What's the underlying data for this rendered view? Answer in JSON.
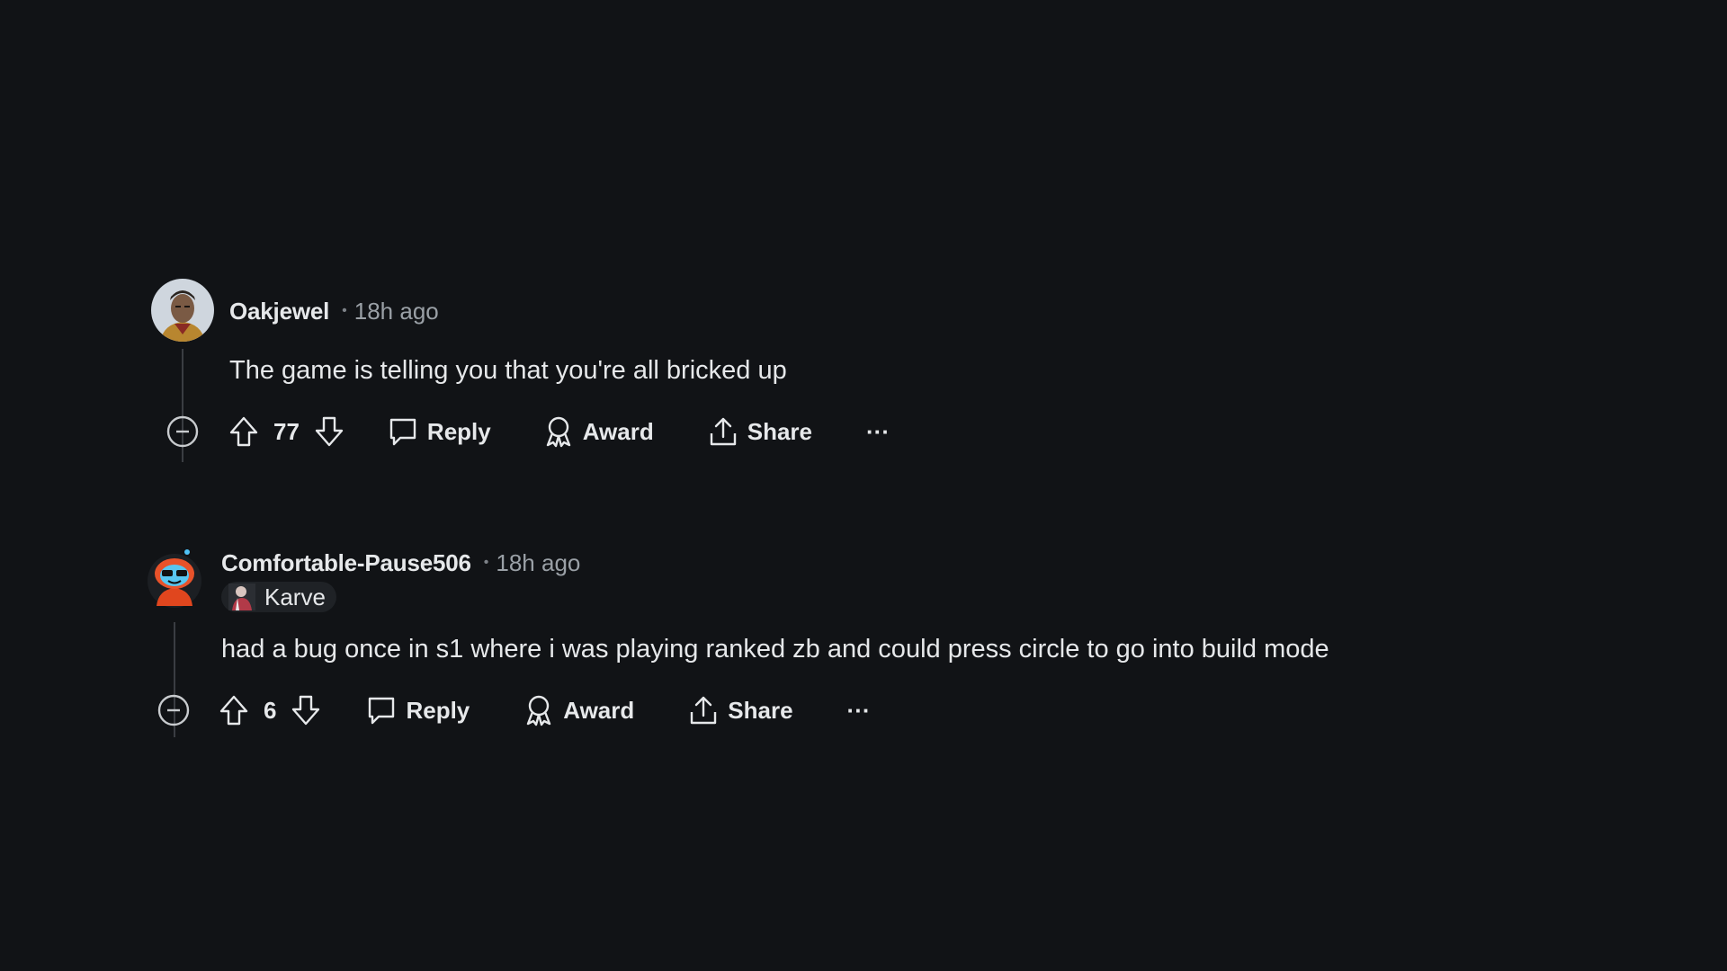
{
  "comments": [
    {
      "author": "Oakjewel",
      "separator": "•",
      "time": "18h ago",
      "flair": null,
      "body": "The game is telling you that you're all bricked up",
      "score": "77",
      "reply_label": "Reply",
      "award_label": "Award",
      "share_label": "Share",
      "more_label": "···",
      "avatar_icon": "avatar-portrait-icon"
    },
    {
      "author": "Comfortable-Pause506",
      "separator": "•",
      "time": "18h ago",
      "flair": {
        "label": "Karve",
        "icon": "flair-character-icon"
      },
      "body": "had a bug once in s1 where i was playing ranked zb and could press circle to go into build mode",
      "score": "6",
      "reply_label": "Reply",
      "award_label": "Award",
      "share_label": "Share",
      "more_label": "···",
      "avatar_icon": "snoo-avatar-icon"
    }
  ],
  "colors": {
    "background": "#111316",
    "text": "#e6e8ea",
    "muted": "#9aa0a6",
    "thread_line": "#3a3d42"
  }
}
